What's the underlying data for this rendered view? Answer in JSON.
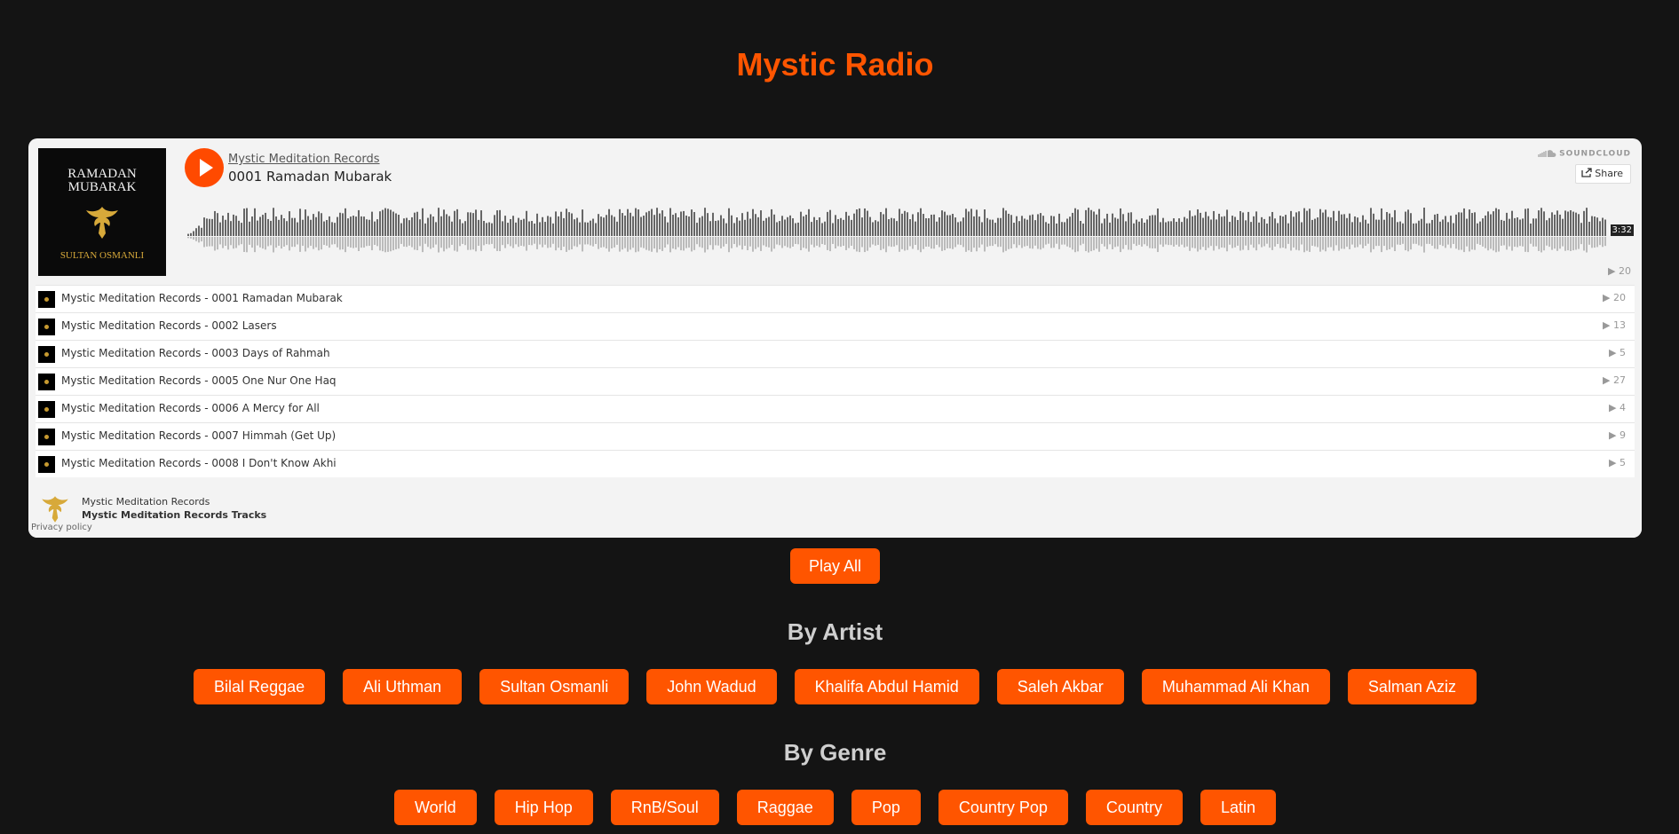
{
  "page": {
    "title": "Mystic Radio"
  },
  "colors": {
    "accent": "#ff5500",
    "background": "#141414",
    "widget_bg": "#f3f3f3"
  },
  "player": {
    "artwork": {
      "title_line1": "RAMADAN",
      "title_line2": "MUBARAK",
      "artist": "SULTAN OSMANLI",
      "icon": "golden-eagle-emblem"
    },
    "uploader": "Mystic Meditation Records",
    "track_title": "0001 Ramadan Mubarak",
    "brand": "SOUNDCLOUD",
    "share_label": "Share",
    "duration": "3:32",
    "plays": "20",
    "tracks": [
      {
        "label": "Mystic Meditation Records - 0001 Ramadan Mubarak",
        "plays": "20"
      },
      {
        "label": "Mystic Meditation Records - 0002 Lasers",
        "plays": "13"
      },
      {
        "label": "Mystic Meditation Records - 0003 Days of Rahmah",
        "plays": "5"
      },
      {
        "label": "Mystic Meditation Records - 0005 One Nur One Haq",
        "plays": "27"
      },
      {
        "label": "Mystic Meditation Records - 0006 A Mercy for All",
        "plays": "4"
      },
      {
        "label": "Mystic Meditation Records - 0007 Himmah (Get Up)",
        "plays": "9"
      },
      {
        "label": "Mystic Meditation Records - 0008 I Don't Know Akhi",
        "plays": "5"
      }
    ],
    "footer": {
      "name": "Mystic Meditation Records",
      "set": "Mystic Meditation Records Tracks",
      "privacy": "Privacy policy"
    }
  },
  "play_all_label": "Play All",
  "by_artist": {
    "heading": "By Artist",
    "artists": [
      "Bilal Reggae",
      "Ali Uthman",
      "Sultan Osmanli",
      "John Wadud",
      "Khalifa Abdul Hamid",
      "Saleh Akbar",
      "Muhammad Ali Khan",
      "Salman Aziz"
    ]
  },
  "by_genre": {
    "heading": "By Genre",
    "genres": [
      "World",
      "Hip Hop",
      "RnB/Soul",
      "Raggae",
      "Pop",
      "Country Pop",
      "Country",
      "Latin"
    ]
  }
}
